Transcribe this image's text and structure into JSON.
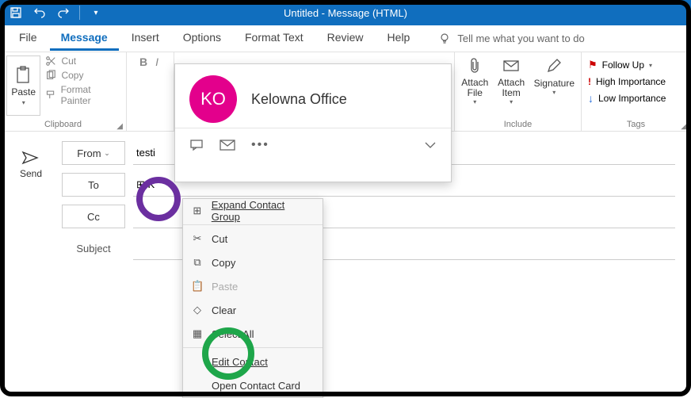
{
  "titlebar": {
    "title": "Untitled  -  Message (HTML)"
  },
  "menu": {
    "file": "File",
    "message": "Message",
    "insert": "Insert",
    "options": "Options",
    "format_text": "Format Text",
    "review": "Review",
    "help": "Help",
    "tell_me": "Tell me what you want to do"
  },
  "ribbon": {
    "clipboard": {
      "paste": "Paste",
      "cut": "Cut",
      "copy": "Copy",
      "format_painter": "Format Painter",
      "group": "Clipboard"
    },
    "basic": {
      "bold": "B",
      "italic": "I"
    },
    "include": {
      "attach_file": "Attach File",
      "attach_item": "Attach Item",
      "signature": "Signature",
      "group": "Include"
    },
    "tags": {
      "follow_up": "Follow Up",
      "high_importance": "High Importance",
      "low_importance": "Low Importance",
      "group": "Tags"
    }
  },
  "compose": {
    "send": "Send",
    "from": "From",
    "to": "To",
    "cc": "Cc",
    "subject": "Subject",
    "from_value": "testi",
    "to_value": "⊞ K"
  },
  "contact_card": {
    "initials": "KO",
    "name": "Kelowna Office"
  },
  "context_menu": {
    "expand": "Expand Contact Group",
    "cut": "Cut",
    "copy": "Copy",
    "paste": "Paste",
    "clear": "Clear",
    "select_all": "Select All",
    "edit_contact": "Edit Contact",
    "open_card": "Open Contact Card"
  }
}
